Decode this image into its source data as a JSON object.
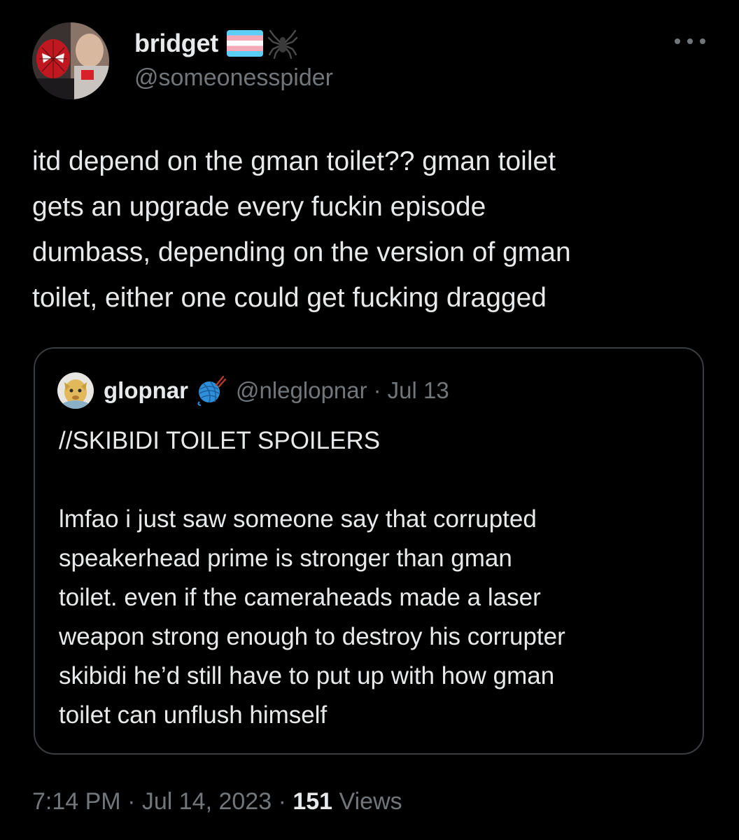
{
  "author": {
    "name": "bridget",
    "handle": "@someonesspider",
    "name_icons": [
      "transgender-flag-icon",
      "spider-icon"
    ]
  },
  "tweet": {
    "lines": [
      "itd depend on the gman toilet?? gman toilet",
      "gets an upgrade every fuckin episode",
      "dumbass, depending on the version of gman",
      "toilet, either one could get fucking dragged"
    ]
  },
  "quote": {
    "name": "glopnar",
    "badge_icon": "yarn-ball-icon",
    "handle": "@nleglopnar",
    "separator": "·",
    "date": "Jul 13",
    "heading": "//SKIBIDI TOILET SPOILERS",
    "lines": [
      "lmfao i just saw someone say that corrupted",
      "speakerhead prime is stronger than gman",
      "toilet. even if the cameraheads made a laser",
      "weapon strong enough to destroy his corrupter",
      "skibidi he’d still have to put up with how gman",
      "toilet can unflush himself"
    ]
  },
  "meta": {
    "time": "7:14 PM",
    "separator": "·",
    "date": "Jul 14, 2023",
    "views_count": "151",
    "views_label": "Views"
  },
  "colors": {
    "background": "#000000",
    "primary_text": "#e7e9ea",
    "secondary_text": "#71767b",
    "border": "#3a3d40",
    "flag_blue": "#5bcefa",
    "flag_pink": "#f5a9b8",
    "flag_white": "#ffffff"
  }
}
